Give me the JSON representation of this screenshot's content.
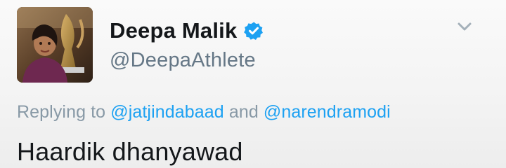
{
  "tweet": {
    "author": {
      "display_name": "Deepa Malik",
      "handle": "@DeepaAthlete",
      "verified": true,
      "avatar_icon": "profile-photo-with-trophy"
    },
    "replying": {
      "prefix": "Replying to",
      "mention_1": "@jatjindabaad",
      "conjunction": "and",
      "mention_2": "@narendramodi"
    },
    "text": "Haardik dhanyawad"
  },
  "colors": {
    "accent": "#1da1f2",
    "verified_badge": "#1da1f2",
    "secondary_text": "#657786",
    "primary_text": "#14171a"
  },
  "icons": {
    "verified": "verified-badge-icon",
    "menu": "chevron-down-icon"
  }
}
